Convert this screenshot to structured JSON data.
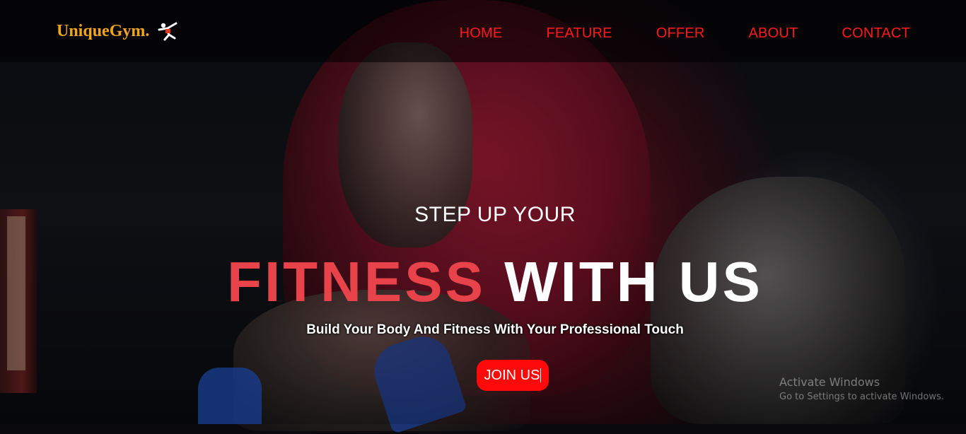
{
  "brand": {
    "name": "UniqueGym.",
    "logo_icon": "gymnast-icon",
    "colors": {
      "brand": "#f2a51a",
      "nav": "#ff1a1a",
      "accent_red": "#e8434a",
      "button": "#ff0a0a"
    }
  },
  "nav": {
    "items": [
      {
        "label": "HOME"
      },
      {
        "label": "FEATURE"
      },
      {
        "label": "OFFER"
      },
      {
        "label": "ABOUT"
      },
      {
        "label": "CONTACT"
      }
    ]
  },
  "hero": {
    "kicker": "STEP UP YOUR",
    "title_part1": "FITNESS",
    "title_part2": "WITH US",
    "subtitle": "Build Your Body And Fitness With Your Professional Touch",
    "cta_label": "JOIN US"
  },
  "watermark": {
    "title": "Activate Windows",
    "subtitle": "Go to Settings to activate Windows."
  }
}
